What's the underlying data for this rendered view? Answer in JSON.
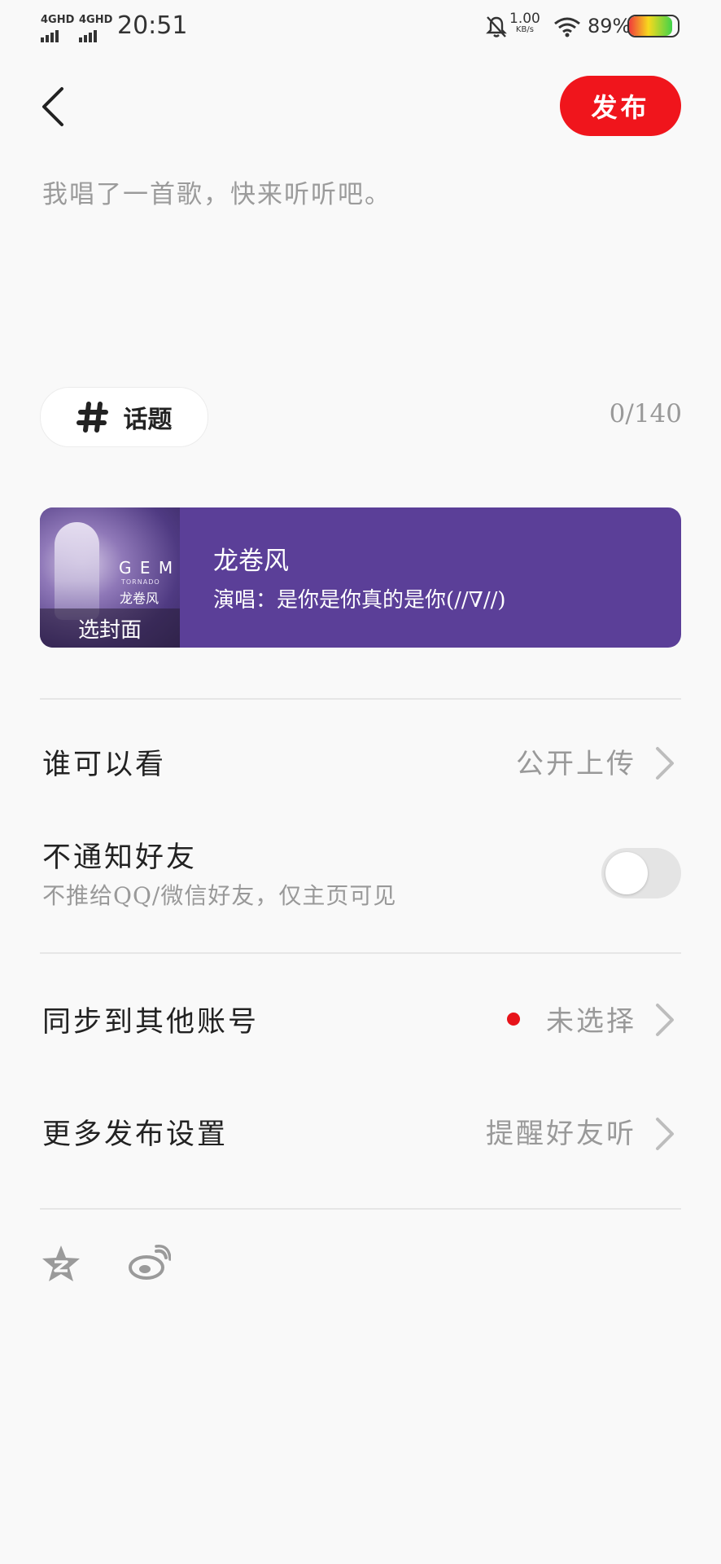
{
  "status_bar": {
    "signal1": "4GHD",
    "signal2": "4GHD",
    "time": "20:51",
    "speed_value": "1.00",
    "speed_unit": "KB/s",
    "battery_percent": "89%",
    "battery_level": 0.89
  },
  "header": {
    "publish_label": "发布"
  },
  "editor": {
    "placeholder": "我唱了一首歌，快来听听吧。",
    "topic_label": "话题",
    "char_counter": "0/140"
  },
  "song_card": {
    "cover_brand": "G E M",
    "cover_sub": "TORNADO",
    "cover_title": "龙卷风",
    "cover_button_label": "选封面",
    "title": "龙卷风",
    "singer": "演唱：是你是你真的是你(//∇//)",
    "background_color": "#5b3f98"
  },
  "settings": {
    "visibility": {
      "label": "谁可以看",
      "value": "公开上传"
    },
    "no_notify": {
      "label": "不通知好友",
      "sub": "不推给QQ/微信好友，仅主页可见",
      "enabled": false
    },
    "sync": {
      "label": "同步到其他账号",
      "value": "未选择"
    },
    "more": {
      "label": "更多发布设置",
      "value": "提醒好友听"
    }
  },
  "share_icons": [
    "qzone-icon",
    "weibo-icon"
  ],
  "colors": {
    "accent": "#f0151c",
    "card": "#5b3f98",
    "dot": "#e7131a"
  }
}
